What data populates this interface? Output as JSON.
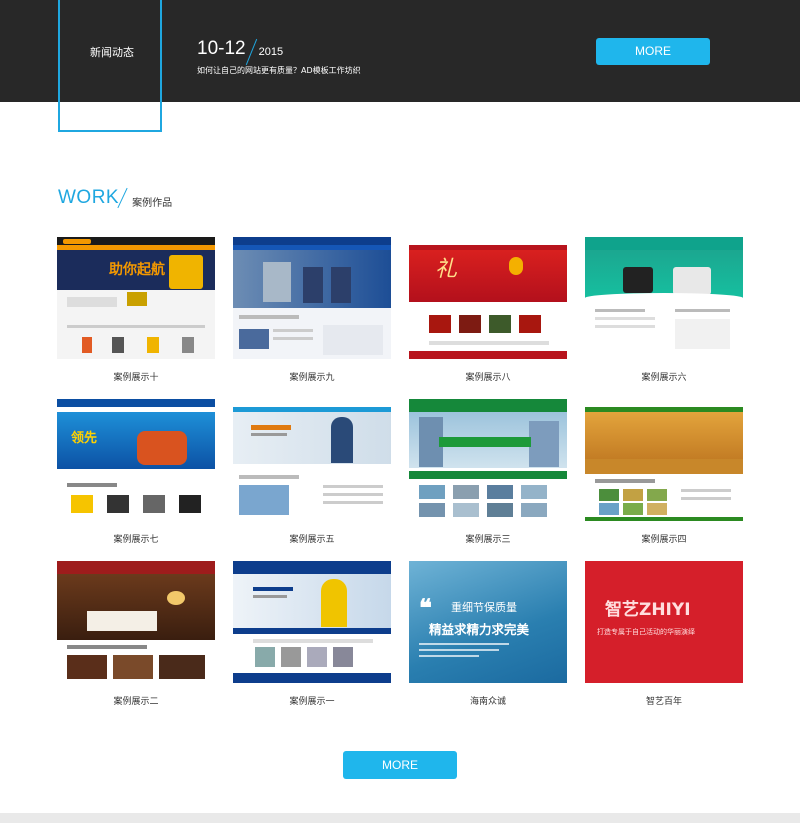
{
  "news": {
    "section_label": "新闻动态",
    "date_md": "10-12",
    "date_year": "2015",
    "headline": "如何让自己的网站更有质量？AD模板工作坊织",
    "more_label": "MORE"
  },
  "work": {
    "title_en": "WORK",
    "title_cn": "案例作品",
    "items": [
      {
        "caption": "案例展示十",
        "thumb_text": "助你起航"
      },
      {
        "caption": "案例展示九",
        "thumb_text": ""
      },
      {
        "caption": "案例展示八",
        "thumb_text": "礼"
      },
      {
        "caption": "案例展示六",
        "thumb_text": ""
      },
      {
        "caption": "案例展示七",
        "thumb_text": "领先"
      },
      {
        "caption": "案例展示五",
        "thumb_text": ""
      },
      {
        "caption": "案例展示三",
        "thumb_text": ""
      },
      {
        "caption": "案例展示四",
        "thumb_text": ""
      },
      {
        "caption": "案例展示二",
        "thumb_text": ""
      },
      {
        "caption": "案例展示一",
        "thumb_text": ""
      },
      {
        "caption": "海南众诚",
        "thumb_text": "重细节保质量",
        "thumb_text2": "精益求精力求完美"
      },
      {
        "caption": "智艺百年",
        "thumb_text": "智艺ZHIYI",
        "thumb_text2": "打造专属于自己活动的华丽演绎"
      }
    ],
    "more_label": "MORE"
  },
  "colors": {
    "accent": "#1fb6ec",
    "dark_bar": "#282828"
  }
}
